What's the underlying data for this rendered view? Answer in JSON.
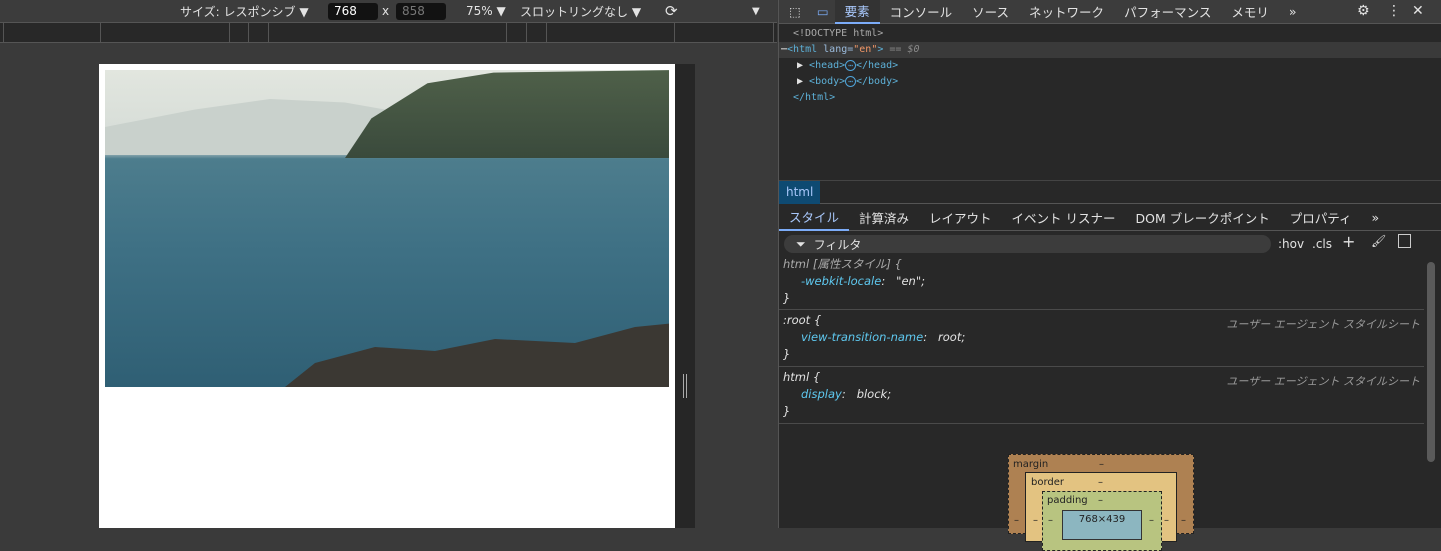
{
  "device_toolbar": {
    "size_label": "サイズ: レスポンシブ ▼",
    "width": "768",
    "x": "x",
    "height": "858",
    "zoom": "75% ▼",
    "throttle": "スロットリングなし ▼",
    "more": "▼"
  },
  "devtools": {
    "tabs": [
      "要素",
      "コンソール",
      "ソース",
      "ネットワーク",
      "パフォーマンス",
      "メモリ",
      "»"
    ],
    "dom": {
      "doctype": "<!DOCTYPE html>",
      "html_open": "<html",
      "lang_attr": " lang=",
      "lang_val": "\"en\"",
      "close": ">",
      "selected_marker": " == $0",
      "head_open": "<head>",
      "head_close": "</head>",
      "body_open": "<body>",
      "body_close": "</body>",
      "html_close": "</html>",
      "ellipsis": "⋯"
    },
    "breadcrumb": "html",
    "subtabs": [
      "スタイル",
      "計算済み",
      "レイアウト",
      "イベント リスナー",
      "DOM ブレークポイント",
      "プロパティ",
      "»"
    ],
    "filter_placeholder": "フィルタ",
    "filter_buttons": [
      ":hov",
      ".cls"
    ],
    "rules": [
      {
        "selector": "html [属性スタイル] {",
        "prop": "-webkit-locale",
        "value": "\"en\";",
        "source": ""
      },
      {
        "selector": ":root {",
        "prop": "view-transition-name",
        "value": "root;",
        "source": "ユーザー エージェント スタイルシート"
      },
      {
        "selector": "html {",
        "prop": "display",
        "value": "block;",
        "source": "ユーザー エージェント スタイルシート"
      }
    ],
    "close_brace": "}",
    "box_model": {
      "margin": "margin",
      "border": "border",
      "padding": "padding",
      "dash": "–",
      "content": "768×439"
    }
  }
}
